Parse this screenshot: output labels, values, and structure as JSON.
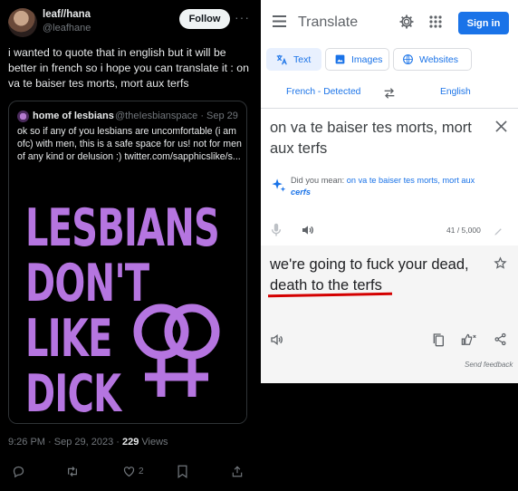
{
  "tweet": {
    "display_name": "leaf//hana",
    "handle": "@leafhane",
    "follow_label": "Follow",
    "more_icon": "more-icon",
    "text": "i wanted to quote that in english but it will be better in french so i hope you can translate it : on va te baiser tes morts, mort aux terfs",
    "quote": {
      "display_name": "home of lesbians",
      "handle": "@theIesbianspace · Sep 29",
      "text": "ok so if any of you lesbians are uncomfortable (i am ofc) with men, this is a safe space for us! not for men of any kind or delusion :) twitter.com/sapphicslike/s...",
      "image_lines": [
        "LESBIANS",
        "DON'T",
        "LIKE",
        "DICK"
      ]
    },
    "meta": {
      "time": "9:26 PM · Sep 29, 2023 · ",
      "views_count": "229",
      "views_label": " Views"
    },
    "actions": {
      "reply_icon": "reply-icon",
      "retweet_icon": "retweet-icon",
      "like_icon": "like-icon",
      "like_count": "2",
      "bookmark_icon": "bookmark-icon",
      "share_icon": "share-icon"
    }
  },
  "translate": {
    "title": "Translate",
    "signin_label": "Sign in",
    "tabs": [
      {
        "label": "Text",
        "active": true
      },
      {
        "label": "Images",
        "active": false
      },
      {
        "label": "Websites",
        "active": false
      }
    ],
    "source_lang": "French - Detected",
    "target_lang": "English",
    "source_text": "on va te baiser tes morts, mort aux terfs",
    "did_you_mean_label": "Did you mean: ",
    "did_you_mean_plain": "on va te baiser tes morts, mort aux ",
    "did_you_mean_bold": "cerfs",
    "char_count": "41 / 5,000",
    "output_text": "we're going to fuck your dead, death to the terfs",
    "send_feedback": "Send feedback",
    "colors": {
      "accent": "#1a73e8",
      "underline": "#d40000",
      "poster": "#b575e0"
    }
  }
}
